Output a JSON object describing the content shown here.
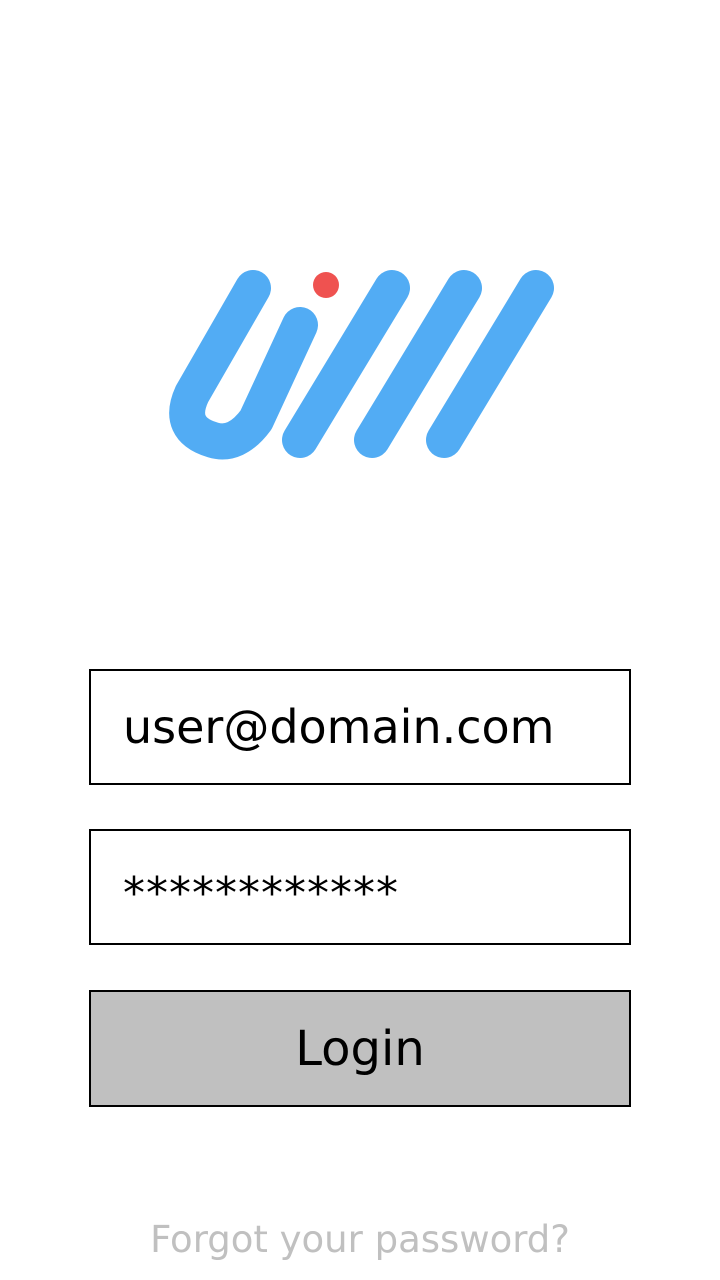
{
  "login": {
    "email_value": "user@domain.com",
    "password_value": "************",
    "login_label": "Login",
    "forgot_label": "Forgot your password?"
  },
  "colors": {
    "brand_blue": "#52acf4",
    "brand_red": "#ef5250",
    "button_bg": "#c0c0c0",
    "link_gray": "#c0c0c0"
  },
  "icons": {
    "logo": "brand-logo"
  }
}
